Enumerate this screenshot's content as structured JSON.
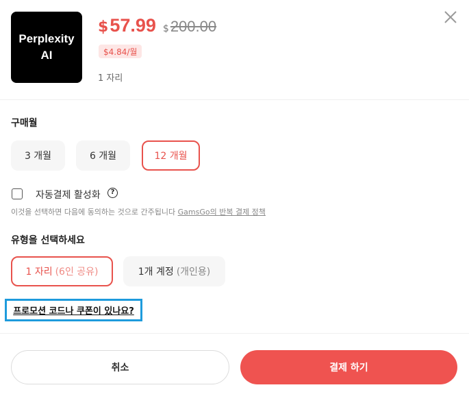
{
  "product": {
    "logo_line1": "Perplexity",
    "logo_line2": "AI",
    "currency": "$",
    "price": "57.99",
    "original_currency": "$",
    "original_price": "200.00",
    "monthly_badge": "$4.84/월",
    "seats": "1 자리",
    "close_icon": "close-icon"
  },
  "purchase_months": {
    "label": "구매월",
    "options": [
      "3 개월",
      "6 개월",
      "12 개월"
    ],
    "selected": "12 개월"
  },
  "autopay": {
    "checked": false,
    "label": "자동결제 활성화",
    "help_icon": "?",
    "note_prefix": "이것을 선택하면 다음에 동의하는 것으로 간주됩니다 ",
    "note_link": "GamsGo의 반복 결제 정책"
  },
  "type": {
    "label": "유형을 선택하세요",
    "options": [
      {
        "main": "1 자리",
        "sub": "(6인 공유)"
      },
      {
        "main": "1개 계정",
        "sub": "(개인용)"
      }
    ],
    "selected": "1 자리"
  },
  "promo": {
    "link": "프로모션 코드나 쿠폰이 있나요?"
  },
  "footer": {
    "cancel": "취소",
    "pay": "결제 하기"
  },
  "colors": {
    "accent": "#e8524c",
    "pay_button": "#ef5350",
    "highlight_box": "#1e9bdc"
  }
}
